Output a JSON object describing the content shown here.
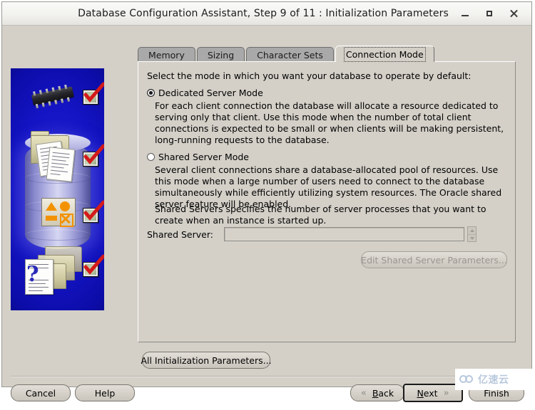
{
  "window": {
    "title": "Database Configuration Assistant, Step 9 of 11 : Initialization Parameters",
    "controls": {
      "minimize": "minimize-icon",
      "maximize": "maximize-icon",
      "close": "close-icon"
    }
  },
  "illustration": {
    "alt": "oracle-dbca-database-illustration",
    "background_color": "#1414c4",
    "items": [
      {
        "icon": "microchip-icon",
        "checked": true
      },
      {
        "icon": "folder-documents-icon",
        "checked": true
      },
      {
        "icon": "shapes-palette-icon",
        "checked": true
      },
      {
        "icon": "folder-question-icon",
        "checked": true
      }
    ],
    "check_color": "#d41a1a"
  },
  "tabs": [
    {
      "label": "Memory",
      "active": false
    },
    {
      "label": "Sizing",
      "active": false
    },
    {
      "label": "Character Sets",
      "active": false
    },
    {
      "label": "Connection Mode",
      "active": true
    }
  ],
  "panel": {
    "intro": "Select the mode in which you want your database to operate by default:",
    "options": [
      {
        "label": "Dedicated Server Mode",
        "selected": true,
        "description": "For each client connection the database will allocate a resource dedicated to serving only that client.  Use this mode when the number of total client connections is expected to be small or when clients will be making persistent, long-running requests to the database."
      },
      {
        "label": "Shared Server Mode",
        "selected": false,
        "description": "Several client connections share a database-allocated pool of resources.  Use this mode when a large number of users need to connect to the database simultaneously while efficiently utilizing system resources.  The Oracle shared server feature will be enabled."
      }
    ],
    "shared_servers_note": "Shared Servers specifies the number of server processes that you want to create when an instance is started up.",
    "shared_server_field": {
      "label": "Shared Server:",
      "value": "",
      "placeholder": "",
      "enabled": false
    },
    "edit_shared_button": {
      "label": "Edit Shared Server Parameters...",
      "enabled": false
    }
  },
  "actions": {
    "all_init_params": "All Initialization Parameters..."
  },
  "footer": {
    "cancel": "Cancel",
    "help": "Help",
    "back": {
      "label": "Back",
      "mnemonic": "B",
      "arrow": "chevron-double-left-icon"
    },
    "next": {
      "label": "Next",
      "mnemonic": "N",
      "arrow": "chevron-double-right-icon",
      "focused": true
    },
    "finish": "Finish"
  },
  "watermark": {
    "text": "亿速云",
    "logo": "double-circle-logo-icon",
    "color": "#b9c9dd"
  }
}
